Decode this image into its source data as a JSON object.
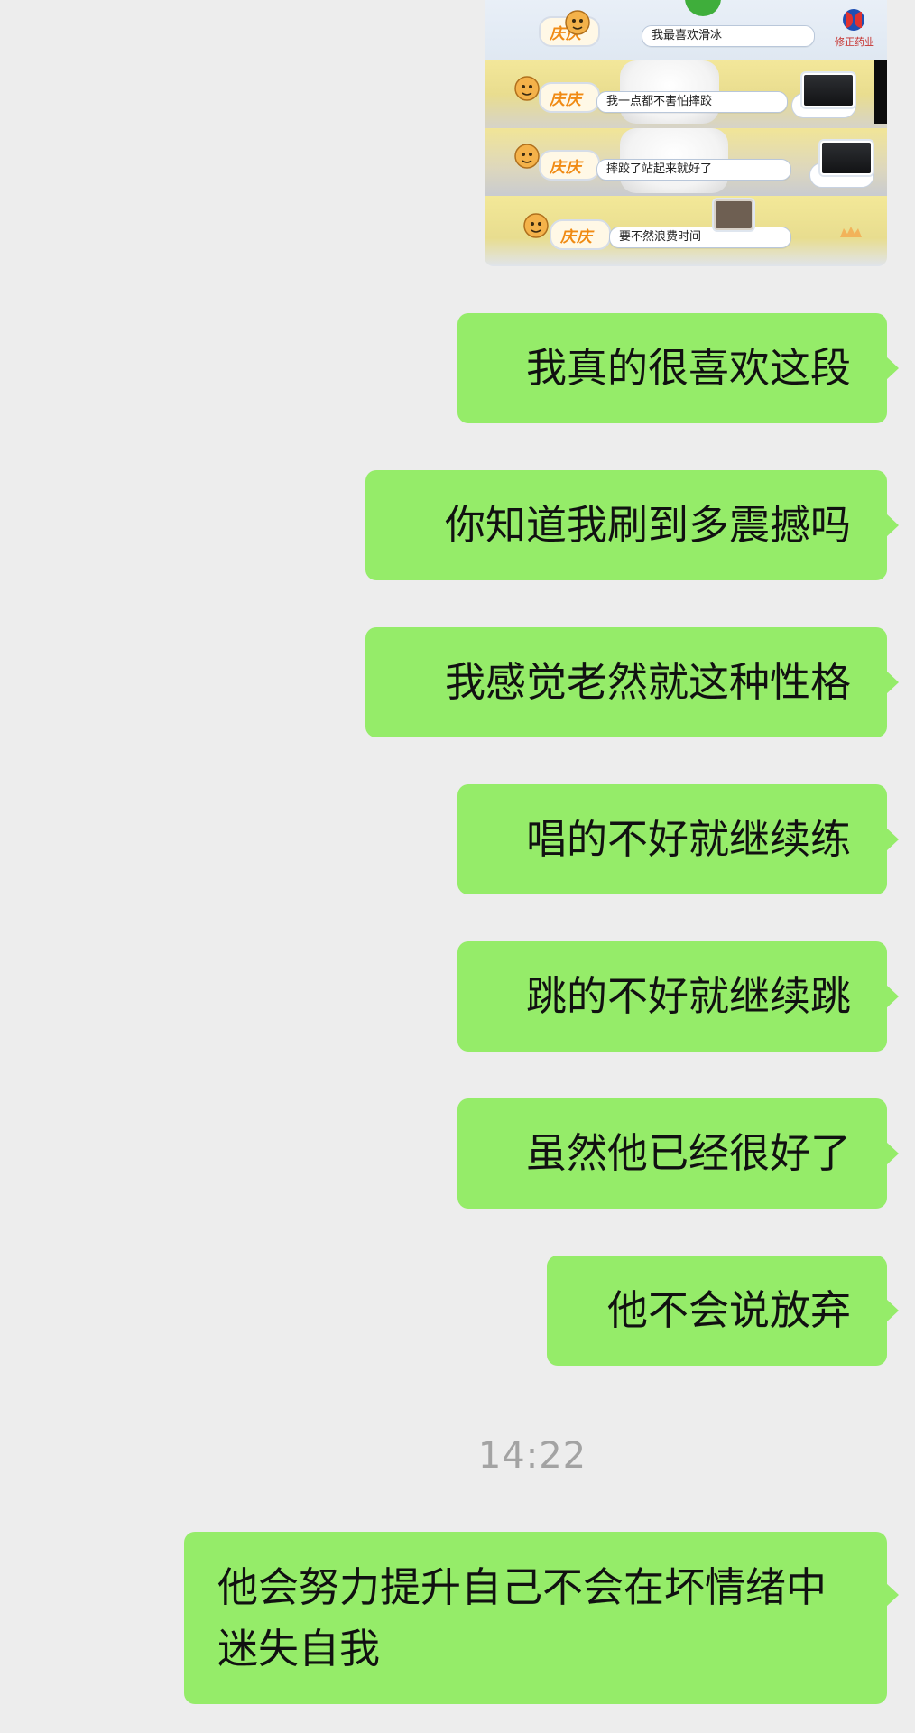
{
  "chat": {
    "image_message": {
      "captions": [
        "我最喜欢滑冰",
        "我一点都不害怕摔跤",
        "摔跤了站起来就好了",
        "要不然浪费时间"
      ],
      "tag_label": "庆庆",
      "logo_word": "修正药业"
    },
    "messages": [
      {
        "text": "我真的很喜欢这段"
      },
      {
        "text": "你知道我刷到多震撼吗"
      },
      {
        "text": "我感觉老然就这种性格"
      },
      {
        "text": "唱的不好就继续练"
      },
      {
        "text": "跳的不好就继续跳"
      },
      {
        "text": "虽然他已经很好了"
      },
      {
        "text": "他不会说放弃"
      },
      {
        "text": "他会努力提升自己不会在坏情绪中迷失自我"
      }
    ],
    "timestamp": "14:22"
  },
  "colors": {
    "background": "#ededed",
    "bubble_outgoing": "#95ec69",
    "text": "#111111",
    "timestamp": "#a3a3a3"
  }
}
